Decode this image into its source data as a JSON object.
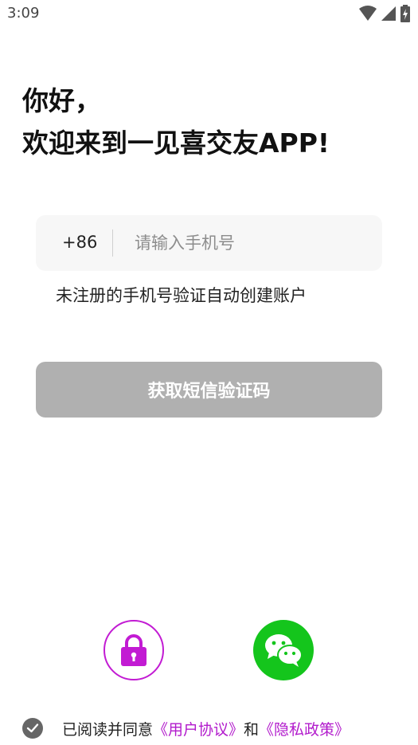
{
  "status_bar": {
    "time": "3:09"
  },
  "greeting": {
    "line1": "你好，",
    "line2": "欢迎来到一见喜交友APP!"
  },
  "phone_form": {
    "country_code": "+86",
    "phone_placeholder": "请输入手机号",
    "phone_value": "",
    "hint": "未注册的手机号验证自动创建账户",
    "get_code_label": "获取短信验证码"
  },
  "alt_login": {
    "lock_icon": "lock-icon",
    "wechat_icon": "wechat-icon"
  },
  "agreement": {
    "prefix": "已阅读并同意",
    "user_agreement": "《用户协议》",
    "and": "和",
    "privacy_policy": "《隐私政策》"
  },
  "colors": {
    "accent": "#b21bcc",
    "wechat_green": "#14c51c",
    "button_disabled": "#b0b0b0",
    "field_bg": "#f7f7f7"
  }
}
